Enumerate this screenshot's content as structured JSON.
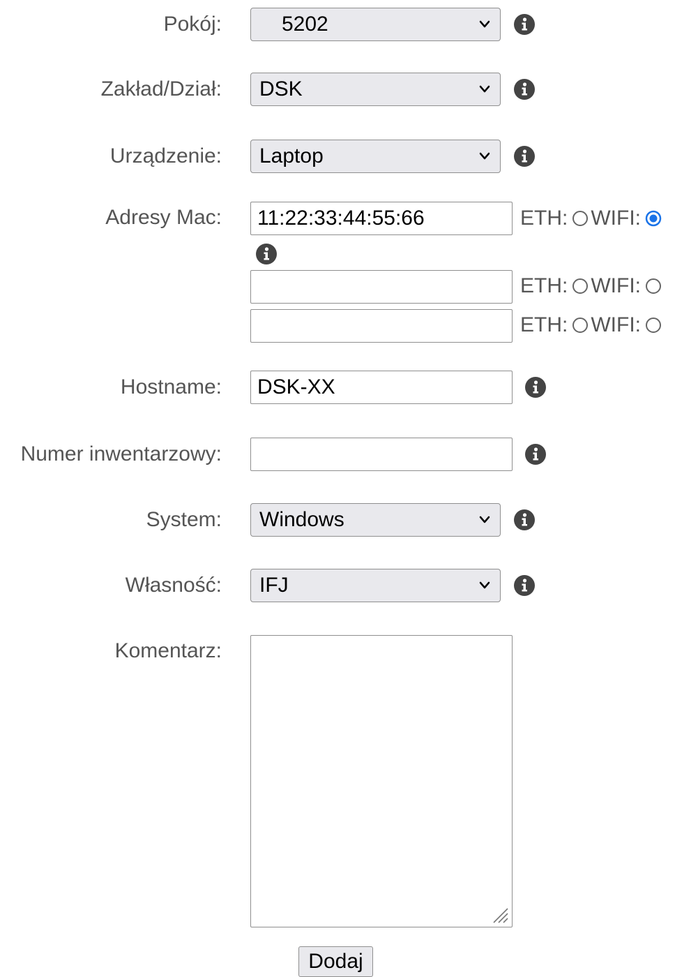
{
  "form": {
    "room": {
      "label": "Pokój:",
      "value": "5202"
    },
    "department": {
      "label": "Zakład/Dział:",
      "value": "DSK"
    },
    "device": {
      "label": "Urządzenie:",
      "value": "Laptop"
    },
    "mac": {
      "label": "Adresy Mac:",
      "eth_label": "ETH:",
      "wifi_label": "WIFI:",
      "entries": [
        {
          "value": "11:22:33:44:55:66",
          "type": "wifi"
        },
        {
          "value": "",
          "type": ""
        },
        {
          "value": "",
          "type": ""
        }
      ]
    },
    "hostname": {
      "label": "Hostname:",
      "value": "DSK-XX"
    },
    "inventory": {
      "label": "Numer inwentarzowy:",
      "value": ""
    },
    "system": {
      "label": "System:",
      "value": "Windows"
    },
    "ownership": {
      "label": "Własność:",
      "value": "IFJ"
    },
    "comment": {
      "label": "Komentarz:",
      "value": ""
    },
    "submit_label": "Dodaj"
  },
  "colors": {
    "label": "#555555",
    "info_icon": "#444444",
    "radio_selected": "#1a73e8"
  }
}
